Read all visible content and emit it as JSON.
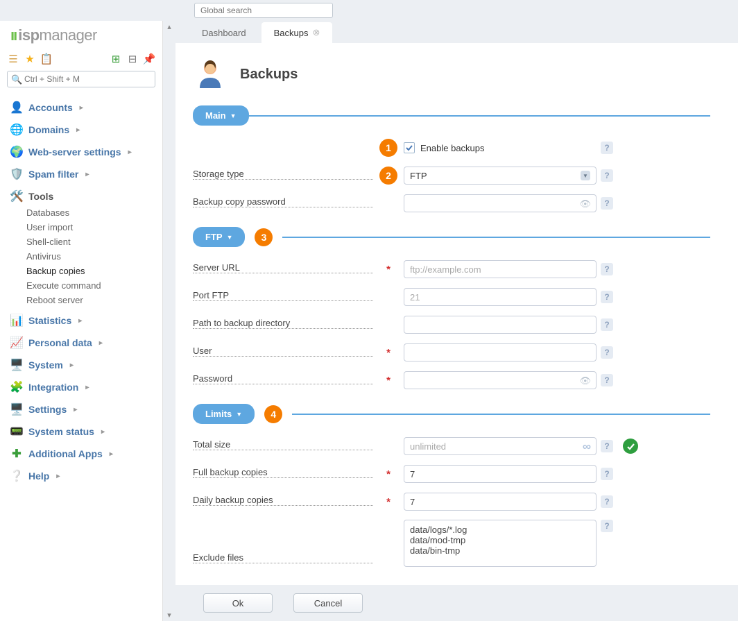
{
  "global_search_placeholder": "Global search",
  "logo": {
    "brand_prefix": "isp",
    "brand_suffix": "manager"
  },
  "side_search_placeholder": "Ctrl + Shift + M",
  "nav": {
    "accounts": "Accounts",
    "domains": "Domains",
    "webserver": "Web-server settings",
    "spam": "Spam filter",
    "tools": "Tools",
    "tools_items": {
      "databases": "Databases",
      "user_import": "User import",
      "shell_client": "Shell-client",
      "antivirus": "Antivirus",
      "backup_copies": "Backup copies",
      "execute_command": "Execute command",
      "reboot_server": "Reboot server"
    },
    "statistics": "Statistics",
    "personal_data": "Personal data",
    "system": "System",
    "integration": "Integration",
    "settings": "Settings",
    "system_status": "System status",
    "additional_apps": "Additional Apps",
    "help": "Help"
  },
  "tabs": {
    "dashboard": "Dashboard",
    "backups": "Backups"
  },
  "page": {
    "title": "Backups"
  },
  "sections": {
    "main": "Main",
    "ftp": "FTP",
    "limits": "Limits"
  },
  "badges": {
    "b1": "1",
    "b2": "2",
    "b3": "3",
    "b4": "4"
  },
  "labels": {
    "enable_backups": "Enable backups",
    "storage_type": "Storage type",
    "backup_copy_password": "Backup copy password",
    "server_url": "Server URL",
    "port_ftp": "Port FTP",
    "path_backup_dir": "Path to backup directory",
    "user": "User",
    "password": "Password",
    "total_size": "Total size",
    "full_backup_copies": "Full backup copies",
    "daily_backup_copies": "Daily backup copies",
    "exclude_files": "Exclude files"
  },
  "values": {
    "storage_type": "FTP",
    "server_url_placeholder": "ftp://example.com",
    "port_ftp_placeholder": "21",
    "total_size_placeholder": "unlimited",
    "full_backup_copies": "7",
    "daily_backup_copies": "7",
    "exclude_files": "data/logs/*.log\ndata/mod-tmp\ndata/bin-tmp"
  },
  "buttons": {
    "ok": "Ok",
    "cancel": "Cancel"
  },
  "required_marker": "*"
}
